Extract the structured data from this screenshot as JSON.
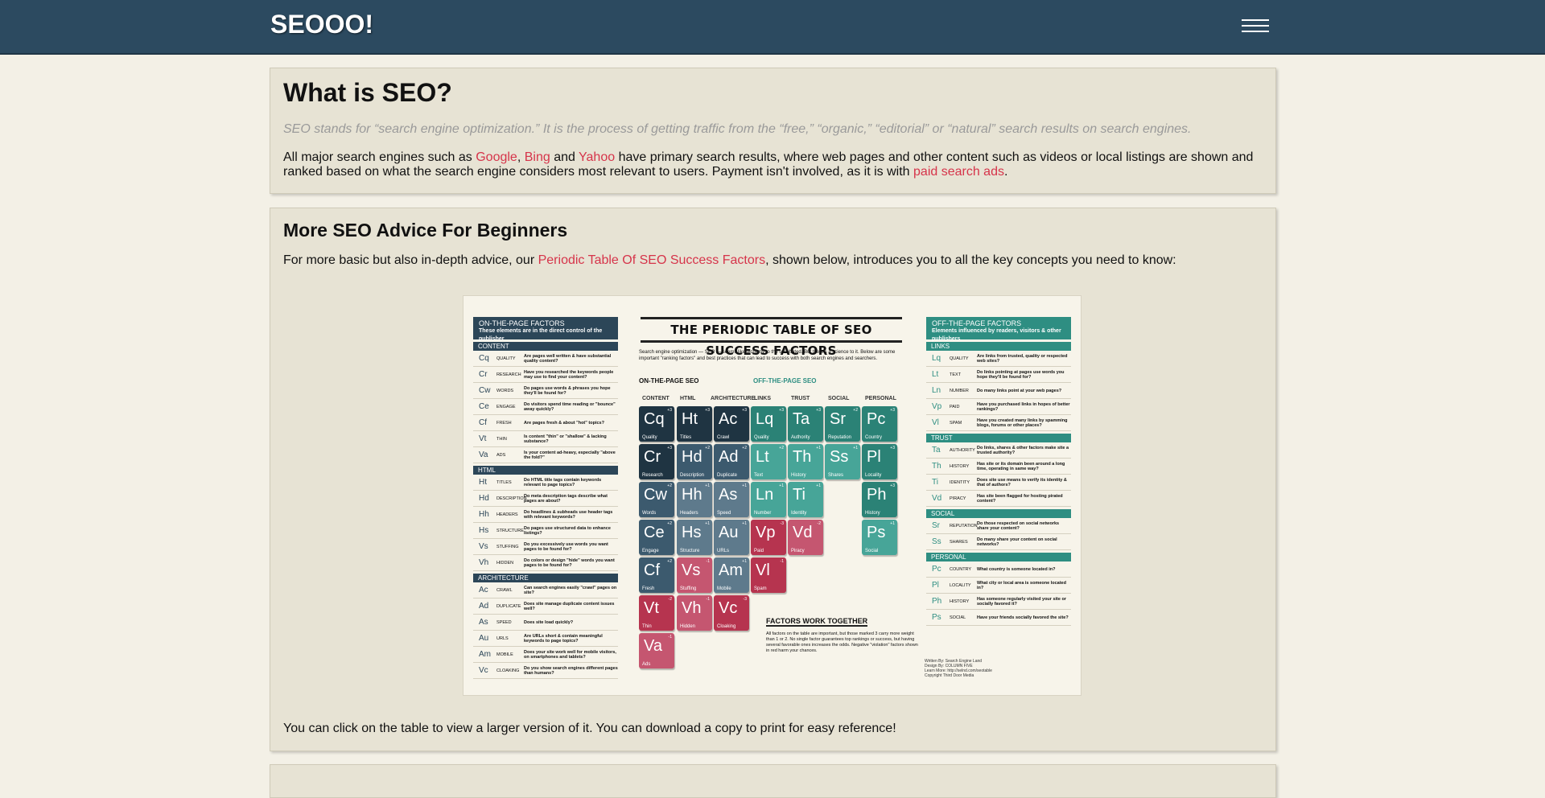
{
  "header": {
    "logo": "SEOOO!"
  },
  "card1": {
    "title": "What is SEO?",
    "lead": "SEO stands for “search engine optimization.” It is the process of getting traffic from the “free,” “organic,” “editorial” or “natural” search results on search engines.",
    "para_start": "All major search engines such as ",
    "link_google": "Google",
    "sep1": ", ",
    "link_bing": "Bing",
    "sep2": " and ",
    "link_yahoo": "Yahoo",
    "para_mid": " have primary search results, where web pages and other content such as videos or local listings are shown and ranked based on what the search engine considers most relevant to users. Payment isn't involved, as it is with ",
    "link_paid": "paid search ads",
    "para_end": "."
  },
  "card2": {
    "title": "More SEO Advice For Beginners",
    "intro_start": "For more basic but also in-depth advice, our ",
    "intro_link": "Periodic Table Of SEO Success Factors",
    "intro_end": ", shown below, introduces you to all the key concepts you need to know:",
    "outro": "You can click on the table to view a larger version of it. You can download a copy to print for easy reference!"
  },
  "ptable": {
    "title": "THE PERIODIC TABLE OF SEO SUCCESS FACTORS",
    "intro": "Search engine optimization — SEO — seems like alchemy to the uninitiated. But there's a science to it. Below are some important \"ranking factors\" and best practices that can lead to success with both search engines and searchers.",
    "grp_on": "ON-THE-PAGE SEO",
    "grp_off": "OFF-THE-PAGE SEO",
    "cols": [
      "CONTENT",
      "HTML",
      "ARCHITECTURE",
      "LINKS",
      "TRUST",
      "SOCIAL",
      "PERSONAL"
    ],
    "left_head": "ON-THE-PAGE FACTORS",
    "left_sub": "These elements are in the direct control of the publisher",
    "right_head": "OFF-THE-PAGE FACTORS",
    "right_sub": "Elements influenced by readers, visitors & other publishers",
    "left_groups": [
      {
        "name": "CONTENT",
        "rows": [
          {
            "sym": "Cq",
            "lab": "QUALITY",
            "desc": "Are pages well written & have substantial quality content?"
          },
          {
            "sym": "Cr",
            "lab": "RESEARCH",
            "desc": "Have you researched the keywords people may use to find your content?"
          },
          {
            "sym": "Cw",
            "lab": "WORDS",
            "desc": "Do pages use words & phrases you hope they'll be found for?"
          },
          {
            "sym": "Ce",
            "lab": "ENGAGE",
            "desc": "Do visitors spend time reading or \"bounce\" away quickly?"
          },
          {
            "sym": "Cf",
            "lab": "FRESH",
            "desc": "Are pages fresh & about \"hot\" topics?"
          },
          {
            "sym": "Vt",
            "lab": "THIN",
            "desc": "Is content \"thin\" or \"shallow\" & lacking substance?"
          },
          {
            "sym": "Va",
            "lab": "ADS",
            "desc": "Is your content ad-heavy, especially \"above the fold?\""
          }
        ]
      },
      {
        "name": "HTML",
        "rows": [
          {
            "sym": "Ht",
            "lab": "TITLES",
            "desc": "Do HTML title tags contain keywords relevant to page topics?"
          },
          {
            "sym": "Hd",
            "lab": "DESCRIPTION",
            "desc": "Do meta description tags describe what pages are about?"
          },
          {
            "sym": "Hh",
            "lab": "HEADERS",
            "desc": "Do headlines & subheads use header tags with relevant keywords?"
          },
          {
            "sym": "Hs",
            "lab": "STRUCTURE",
            "desc": "Do pages use structured data to enhance listings?"
          },
          {
            "sym": "Vs",
            "lab": "STUFFING",
            "desc": "Do you excessively use words you want pages to be found for?"
          },
          {
            "sym": "Vh",
            "lab": "HIDDEN",
            "desc": "Do colors or design \"hide\" words you want pages to be found for?"
          }
        ]
      },
      {
        "name": "ARCHITECTURE",
        "rows": [
          {
            "sym": "Ac",
            "lab": "CRAWL",
            "desc": "Can search engines easily \"crawl\" pages on site?"
          },
          {
            "sym": "Ad",
            "lab": "DUPLICATE",
            "desc": "Does site manage duplicate content issues well?"
          },
          {
            "sym": "As",
            "lab": "SPEED",
            "desc": "Does site load quickly?"
          },
          {
            "sym": "Au",
            "lab": "URLS",
            "desc": "Are URLs short & contain meaningful keywords to page topics?"
          },
          {
            "sym": "Am",
            "lab": "MOBILE",
            "desc": "Does your site work well for mobile visitors, on smartphones and tablets?"
          },
          {
            "sym": "Vc",
            "lab": "CLOAKING",
            "desc": "Do you show search engines different pages than humans?"
          }
        ]
      }
    ],
    "right_groups": [
      {
        "name": "LINKS",
        "rows": [
          {
            "sym": "Lq",
            "lab": "QUALITY",
            "desc": "Are links from trusted, quality or respected web sites?"
          },
          {
            "sym": "Lt",
            "lab": "TEXT",
            "desc": "Do links pointing at pages use words you hope they'll be found for?"
          },
          {
            "sym": "Ln",
            "lab": "NUMBER",
            "desc": "Do many links point at your web pages?"
          },
          {
            "sym": "Vp",
            "lab": "PAID",
            "desc": "Have you purchased links in hopes of better rankings?"
          },
          {
            "sym": "Vl",
            "lab": "SPAM",
            "desc": "Have you created many links by spamming blogs, forums or other places?"
          }
        ]
      },
      {
        "name": "TRUST",
        "rows": [
          {
            "sym": "Ta",
            "lab": "AUTHORITY",
            "desc": "Do links, shares & other factors make site a trusted authority?"
          },
          {
            "sym": "Th",
            "lab": "HISTORY",
            "desc": "Has site or its domain been around a long time, operating in same way?"
          },
          {
            "sym": "Ti",
            "lab": "IDENTITY",
            "desc": "Does site use means to verify its identity & that of authors?"
          },
          {
            "sym": "Vd",
            "lab": "PIRACY",
            "desc": "Has site been flagged for hosting pirated content?"
          }
        ]
      },
      {
        "name": "SOCIAL",
        "rows": [
          {
            "sym": "Sr",
            "lab": "REPUTATION",
            "desc": "Do those respected on social networks share your content?"
          },
          {
            "sym": "Ss",
            "lab": "SHARES",
            "desc": "Do many share your content on social networks?"
          }
        ]
      },
      {
        "name": "PERSONAL",
        "rows": [
          {
            "sym": "Pc",
            "lab": "COUNTRY",
            "desc": "What country is someone located in?"
          },
          {
            "sym": "Pl",
            "lab": "LOCALITY",
            "desc": "What city or local area is someone located in?"
          },
          {
            "sym": "Ph",
            "lab": "HISTORY",
            "desc": "Has someone regularly visited your site or socially favored it?"
          },
          {
            "sym": "Ps",
            "lab": "SOCIAL",
            "desc": "Have your friends socially favored the site?"
          }
        ]
      }
    ],
    "elements": [
      {
        "s": "Cq",
        "n": "Quality",
        "w": "+3",
        "c": "c-dark",
        "col": 0,
        "row": 0
      },
      {
        "s": "Ht",
        "n": "Titles",
        "w": "+3",
        "c": "c-dark",
        "col": 1,
        "row": 0
      },
      {
        "s": "Ac",
        "n": "Crawl",
        "w": "+3",
        "c": "c-dark",
        "col": 2,
        "row": 0
      },
      {
        "s": "Lq",
        "n": "Quality",
        "w": "+3",
        "c": "c-teal",
        "col": 3,
        "row": 0
      },
      {
        "s": "Ta",
        "n": "Authority",
        "w": "+3",
        "c": "c-teal",
        "col": 4,
        "row": 0
      },
      {
        "s": "Sr",
        "n": "Reputation",
        "w": "+2",
        "c": "c-teal",
        "col": 5,
        "row": 0
      },
      {
        "s": "Pc",
        "n": "Country",
        "w": "+3",
        "c": "c-teal",
        "col": 6,
        "row": 0
      },
      {
        "s": "Cr",
        "n": "Research",
        "w": "+3",
        "c": "c-dark",
        "col": 0,
        "row": 1
      },
      {
        "s": "Hd",
        "n": "Description",
        "w": "+2",
        "c": "c-mid",
        "col": 1,
        "row": 1
      },
      {
        "s": "Ad",
        "n": "Duplicate",
        "w": "+2",
        "c": "c-mid",
        "col": 2,
        "row": 1
      },
      {
        "s": "Lt",
        "n": "Text",
        "w": "+2",
        "c": "c-teal2",
        "col": 3,
        "row": 1
      },
      {
        "s": "Th",
        "n": "History",
        "w": "+1",
        "c": "c-teal2",
        "col": 4,
        "row": 1
      },
      {
        "s": "Ss",
        "n": "Shares",
        "w": "+1",
        "c": "c-teal2",
        "col": 5,
        "row": 1
      },
      {
        "s": "Pl",
        "n": "Locality",
        "w": "+3",
        "c": "c-teal",
        "col": 6,
        "row": 1
      },
      {
        "s": "Cw",
        "n": "Words",
        "w": "+2",
        "c": "c-mid",
        "col": 0,
        "row": 2
      },
      {
        "s": "Hh",
        "n": "Headers",
        "w": "+1",
        "c": "c-light",
        "col": 1,
        "row": 2
      },
      {
        "s": "As",
        "n": "Speed",
        "w": "+1",
        "c": "c-light",
        "col": 2,
        "row": 2
      },
      {
        "s": "Ln",
        "n": "Number",
        "w": "+1",
        "c": "c-teal2",
        "col": 3,
        "row": 2
      },
      {
        "s": "Ti",
        "n": "Identity",
        "w": "+1",
        "c": "c-teal2",
        "col": 4,
        "row": 2
      },
      {
        "s": "Ph",
        "n": "History",
        "w": "+3",
        "c": "c-teal",
        "col": 6,
        "row": 2
      },
      {
        "s": "Ce",
        "n": "Engage",
        "w": "+2",
        "c": "c-mid",
        "col": 0,
        "row": 3
      },
      {
        "s": "Hs",
        "n": "Structure",
        "w": "+1",
        "c": "c-light",
        "col": 1,
        "row": 3
      },
      {
        "s": "Au",
        "n": "URLs",
        "w": "+1",
        "c": "c-light",
        "col": 2,
        "row": 3
      },
      {
        "s": "Vp",
        "n": "Paid",
        "w": "-3",
        "c": "c-red",
        "col": 3,
        "row": 3
      },
      {
        "s": "Vd",
        "n": "Piracy",
        "w": "-2",
        "c": "c-red2",
        "col": 4,
        "row": 3
      },
      {
        "s": "Ps",
        "n": "Social",
        "w": "+1",
        "c": "c-teal2",
        "col": 6,
        "row": 3
      },
      {
        "s": "Cf",
        "n": "Fresh",
        "w": "+2",
        "c": "c-mid",
        "col": 0,
        "row": 4
      },
      {
        "s": "Vs",
        "n": "Stuffing",
        "w": "-1",
        "c": "c-red2",
        "col": 1,
        "row": 4
      },
      {
        "s": "Am",
        "n": "Mobile",
        "w": "+1",
        "c": "c-light",
        "col": 2,
        "row": 4
      },
      {
        "s": "Vl",
        "n": "Spam",
        "w": "-1",
        "c": "c-red",
        "col": 3,
        "row": 4
      },
      {
        "s": "Vt",
        "n": "Thin",
        "w": "-2",
        "c": "c-red",
        "col": 0,
        "row": 5
      },
      {
        "s": "Vh",
        "n": "Hidden",
        "w": "-1",
        "c": "c-red2",
        "col": 1,
        "row": 5
      },
      {
        "s": "Vc",
        "n": "Cloaking",
        "w": "-3",
        "c": "c-red",
        "col": 2,
        "row": 5
      },
      {
        "s": "Va",
        "n": "Ads",
        "w": "-1",
        "c": "c-red2",
        "col": 0,
        "row": 6
      }
    ],
    "together_title": "FACTORS WORK TOGETHER",
    "together_text": "All factors on the table are important, but those marked 3 carry more weight than 1 or 2. No single factor guarantees top rankings or success, but having several favorable ones increases the odds. Negative \"violation\" factors shown in red harm your chances.",
    "credit_written": "Written By: Search Engine Land",
    "credit_design": "Design By: COLUMN FIVE",
    "credit_learn": "Learn More: http://selnd.com/seotable",
    "credit_copy": "Copyright Third Door Media"
  }
}
